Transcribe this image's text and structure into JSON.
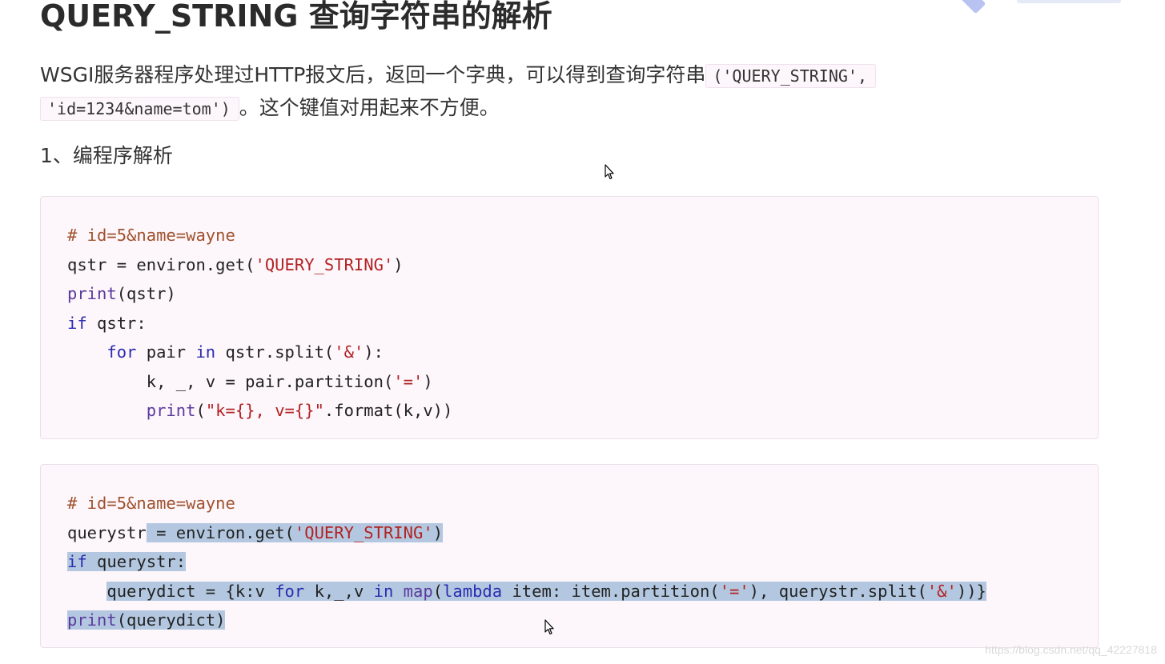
{
  "title": "QUERY_STRING 查询字符串的解析",
  "intro": {
    "text_before": "WSGI服务器程序处理过HTTP报文后，返回一个字典，可以得到查询字符串",
    "inline_code_1": "('QUERY_STRING',",
    "inline_code_2": "'id=1234&name=tom')",
    "text_after": "。这个键值对用起来不方便。"
  },
  "section_heading": "1、编程序解析",
  "code_block_1": {
    "lines": [
      [
        {
          "t": "# id=5&name=wayne",
          "c": "cm"
        }
      ],
      [
        {
          "t": "qstr = environ.get(",
          "c": ""
        },
        {
          "t": "'QUERY_STRING'",
          "c": "st"
        },
        {
          "t": ")",
          "c": ""
        }
      ],
      [
        {
          "t": "print",
          "c": "bi"
        },
        {
          "t": "(qstr)",
          "c": ""
        }
      ],
      [
        {
          "t": "if",
          "c": "kw"
        },
        {
          "t": " qstr:",
          "c": ""
        }
      ],
      [
        {
          "t": "    ",
          "c": ""
        },
        {
          "t": "for",
          "c": "kw"
        },
        {
          "t": " pair ",
          "c": ""
        },
        {
          "t": "in",
          "c": "kw"
        },
        {
          "t": " qstr.split(",
          "c": ""
        },
        {
          "t": "'&'",
          "c": "st"
        },
        {
          "t": "):",
          "c": ""
        }
      ],
      [
        {
          "t": "        k, _, v = pair.partition(",
          "c": ""
        },
        {
          "t": "'='",
          "c": "st"
        },
        {
          "t": ")",
          "c": ""
        }
      ],
      [
        {
          "t": "        ",
          "c": ""
        },
        {
          "t": "print",
          "c": "bi"
        },
        {
          "t": "(",
          "c": ""
        },
        {
          "t": "\"k={}, v={}\"",
          "c": "st"
        },
        {
          "t": ".format(k,v))",
          "c": ""
        }
      ]
    ]
  },
  "code_block_2": {
    "lines": [
      [
        {
          "t": "# id=5&name=wayne",
          "c": "cm"
        }
      ],
      [
        {
          "t": "querystr",
          "c": ""
        },
        {
          "t": " = environ.get(",
          "c": "",
          "sel": true
        },
        {
          "t": "'QUERY_STRING'",
          "c": "st",
          "sel": true
        },
        {
          "t": ")",
          "c": "",
          "sel": true
        }
      ],
      [
        {
          "t": "if",
          "c": "kw",
          "sel": true
        },
        {
          "t": " querystr:",
          "c": "",
          "sel": true
        }
      ],
      [
        {
          "t": "    ",
          "c": ""
        },
        {
          "t": "querydict = {k:v ",
          "c": "",
          "sel": true
        },
        {
          "t": "for",
          "c": "kw",
          "sel": true
        },
        {
          "t": " k,_,v ",
          "c": "",
          "sel": true
        },
        {
          "t": "in",
          "c": "kw",
          "sel": true
        },
        {
          "t": " ",
          "c": "",
          "sel": true
        },
        {
          "t": "map",
          "c": "bi",
          "sel": true
        },
        {
          "t": "(",
          "c": "",
          "sel": true
        },
        {
          "t": "lambda",
          "c": "kw",
          "sel": true
        },
        {
          "t": " item: item.partition(",
          "c": "",
          "sel": true
        },
        {
          "t": "'='",
          "c": "st",
          "sel": true
        },
        {
          "t": "), querystr.split(",
          "c": "",
          "sel": true
        },
        {
          "t": "'&'",
          "c": "st",
          "sel": true
        },
        {
          "t": "))}",
          "c": "",
          "sel": true
        }
      ],
      [
        {
          "t": "print",
          "c": "bi",
          "sel": true
        },
        {
          "t": "(querydict)",
          "c": "",
          "sel": true
        }
      ]
    ]
  },
  "watermark": "https://blog.csdn.net/qq_42227818",
  "colors": {
    "comment": "#a0522d",
    "keyword": "#2c2cb0",
    "builtin": "#5b3a9e",
    "string": "#b22222",
    "code_background": "#fdf6fb",
    "selection": "#b3c8e0"
  },
  "icons": {
    "cursor": "mouse-pointer-icon"
  }
}
